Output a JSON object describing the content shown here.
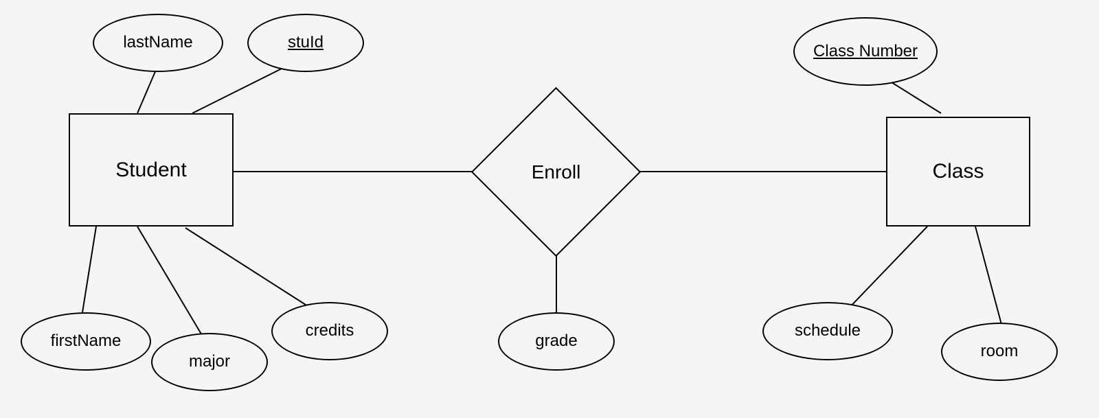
{
  "entities": {
    "student": {
      "label": "Student",
      "attributes": {
        "lastName": "lastName",
        "stuId": "stuId",
        "firstName": "firstName",
        "major": "major",
        "credits": "credits"
      }
    },
    "class": {
      "label": "Class",
      "attributes": {
        "classNumber": "Class Number",
        "schedule": "schedule",
        "room": "room"
      }
    }
  },
  "relationships": {
    "enroll": {
      "label": "Enroll",
      "attributes": {
        "grade": "grade"
      }
    }
  }
}
